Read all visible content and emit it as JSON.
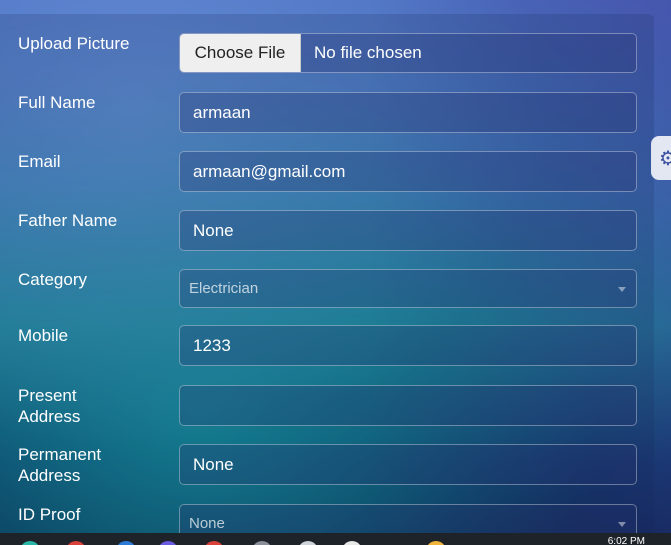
{
  "form": {
    "upload": {
      "label": "Upload Picture",
      "button": "Choose File",
      "status": "No file chosen"
    },
    "full_name": {
      "label": "Full Name",
      "value": "armaan"
    },
    "email": {
      "label": "Email",
      "value": "armaan@gmail.com"
    },
    "father_name": {
      "label": "Father Name",
      "value": "None"
    },
    "category": {
      "label": "Category",
      "value": "Electrician"
    },
    "mobile": {
      "label": "Mobile",
      "value": "1233"
    },
    "present_address": {
      "label_line1": "Present",
      "label_line2": "Address",
      "value": ""
    },
    "permanent_address": {
      "label_line1": "Permanent",
      "label_line2": "Address",
      "value": "None"
    },
    "id_proof": {
      "label": "ID Proof",
      "value": "None"
    }
  },
  "settings_tab": {
    "icon": "gear-icon"
  },
  "taskbar": {
    "time": "6:02 PM"
  },
  "colors": {
    "accent": "#6a6fe0",
    "taskbar": "#1e2229"
  }
}
